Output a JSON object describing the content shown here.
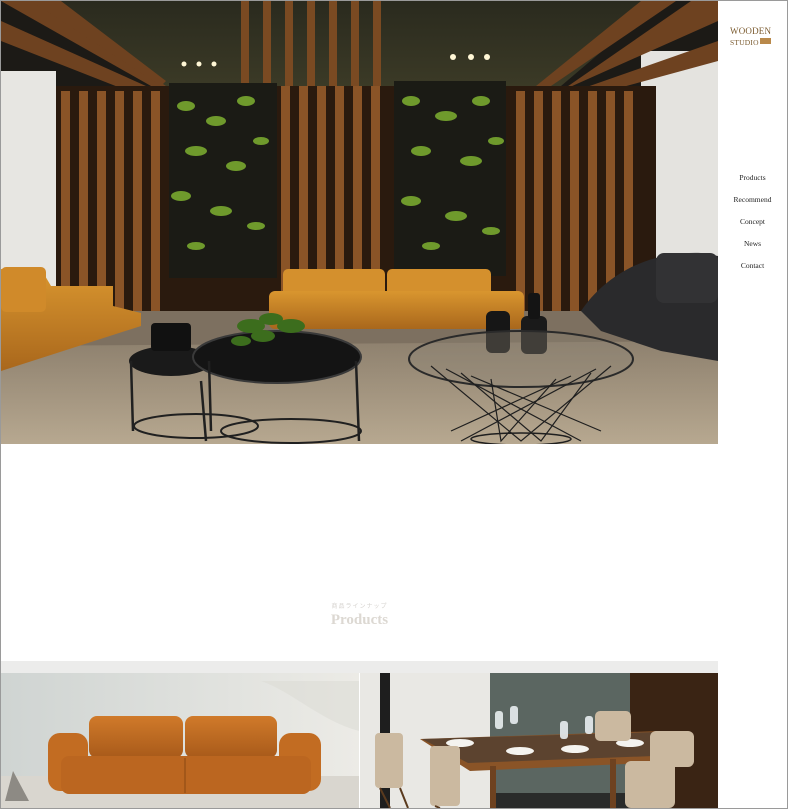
{
  "brand": {
    "line1": "WOODEN",
    "line2": "STUDIO"
  },
  "nav": {
    "items": [
      {
        "label": "Products"
      },
      {
        "label": "Recommend"
      },
      {
        "label": "Concept"
      },
      {
        "label": "News"
      },
      {
        "label": "Contact"
      }
    ]
  },
  "hero": {
    "image": "lounge-interior-photo"
  },
  "products_section": {
    "subtitle": "商品ラインナップ",
    "title": "Products"
  },
  "product_tiles": [
    {
      "image": "orange-leather-sofa-photo"
    },
    {
      "image": "dining-table-photo"
    }
  ],
  "colors": {
    "brand_gold": "#7a5a2e",
    "leather_orange": "#c98a2c",
    "wood_slat": "#7a4a22"
  }
}
